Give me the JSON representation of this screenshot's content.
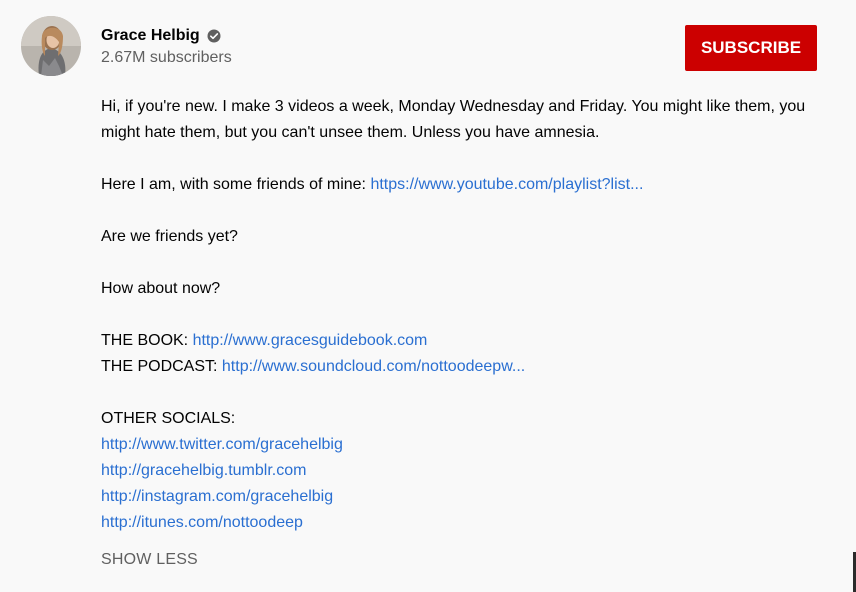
{
  "channel": {
    "name": "Grace Helbig",
    "subscribers": "2.67M subscribers",
    "subscribe_label": "SUBSCRIBE",
    "avatar_icon": "channel-avatar",
    "verified_icon": "verified-check-icon"
  },
  "description": {
    "intro": "Hi, if you're new. I make 3 videos a week, Monday Wednesday and Friday. You might like them, you might hate them, but you can't unsee them. Unless you have amnesia.",
    "friends_prefix": "Here I am, with some friends of mine: ",
    "friends_link": "https://www.youtube.com/playlist?list...",
    "friends_yet": "Are we friends yet?",
    "how_about": "How about now?",
    "book_prefix": "THE BOOK: ",
    "book_link": "http://www.gracesguidebook.com",
    "podcast_prefix": "THE PODCAST: ",
    "podcast_link": "http://www.soundcloud.com/nottoodeepw...",
    "socials_heading": "OTHER SOCIALS:",
    "socials": [
      "http://www.twitter.com/gracehelbig",
      "http://gracehelbig.tumblr.com",
      "http://instagram.com/gracehelbig",
      "http://itunes.com/nottoodeep"
    ]
  },
  "show_less_label": "SHOW LESS",
  "colors": {
    "background": "#f9f9f9",
    "subscribe": "#cc0000",
    "link": "#2a6fd1",
    "secondary_text": "#606060"
  }
}
